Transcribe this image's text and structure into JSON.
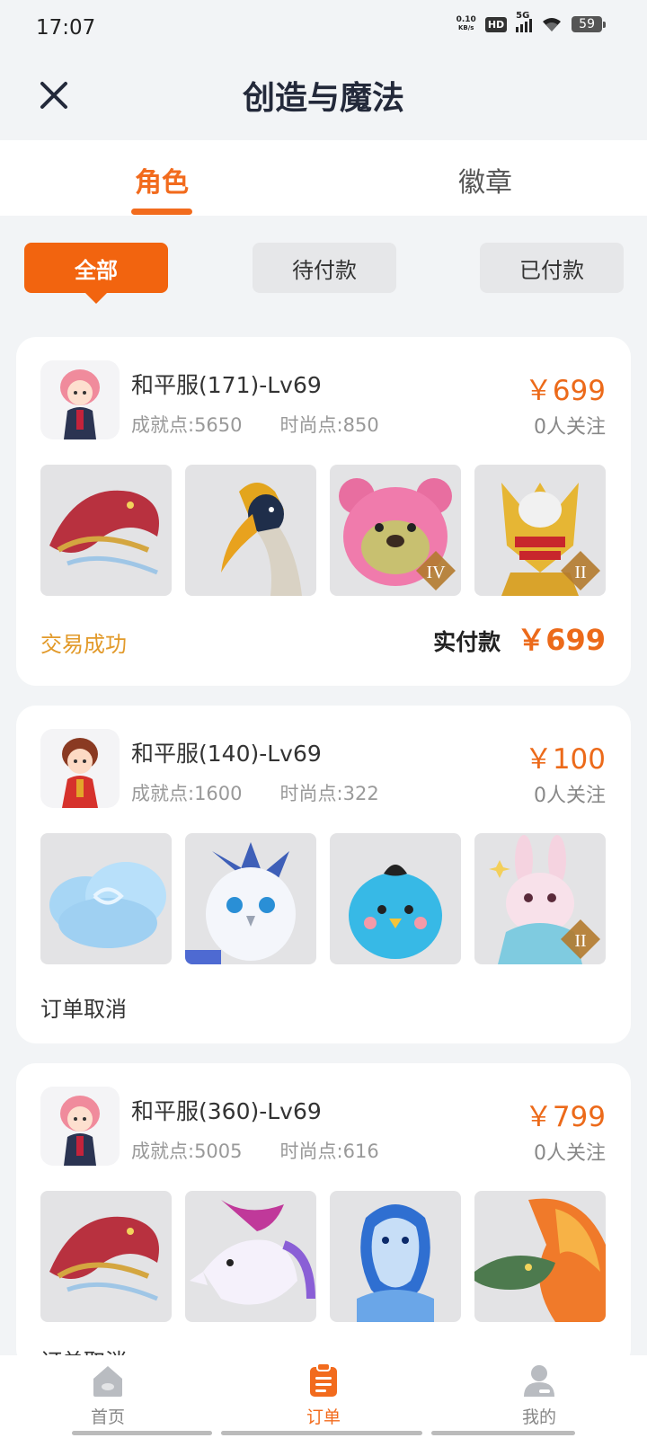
{
  "status_bar": {
    "time": "17:07",
    "net_speed_value": "0.10",
    "net_speed_unit": "KB/s",
    "hd": "HD",
    "network": "5G",
    "battery": "59"
  },
  "header": {
    "title": "创造与魔法",
    "close_icon": "close-icon"
  },
  "tabs": [
    {
      "label": "角色",
      "active": true
    },
    {
      "label": "徽章",
      "active": false
    }
  ],
  "filters": [
    {
      "label": "全部",
      "active": true
    },
    {
      "label": "待付款",
      "active": false
    },
    {
      "label": "已付款",
      "active": false
    }
  ],
  "orders": [
    {
      "title": "和平服(171)-Lv69",
      "achievement": "成就点:5650",
      "fashion": "时尚点:850",
      "price": "￥699",
      "followers": "0人关注",
      "status": "交易成功",
      "paid_label": "实付款",
      "paid_amount": "￥699",
      "thumbs": [
        "red-dragon",
        "hornbill",
        "pink-bear",
        "golden-armor"
      ],
      "tiers": [
        "",
        "",
        "IV",
        "II"
      ]
    },
    {
      "title": "和平服(140)-Lv69",
      "achievement": "成就点:1600",
      "fashion": "时尚点:322",
      "price": "￥100",
      "followers": "0人关注",
      "status": "订单取消",
      "thumbs": [
        "cloud",
        "white-owl",
        "blue-bird",
        "pink-rabbit"
      ],
      "tiers": [
        "",
        "",
        "",
        "II"
      ]
    },
    {
      "title": "和平服(360)-Lv69",
      "achievement": "成就点:5005",
      "fashion": "时尚点:616",
      "price": "￥799",
      "followers": "0人关注",
      "status": "订单取消",
      "thumbs": [
        "red-dragon",
        "white-deer",
        "blue-dragon",
        "fire-dragon"
      ],
      "tiers": [
        "",
        "",
        "",
        ""
      ]
    }
  ],
  "bottom_nav": [
    {
      "label": "首页",
      "icon": "home-icon",
      "active": false
    },
    {
      "label": "订单",
      "icon": "orders-icon",
      "active": true
    },
    {
      "label": "我的",
      "icon": "profile-icon",
      "active": false
    }
  ],
  "colors": {
    "accent": "#f26b1d",
    "success_status": "#e29a2a",
    "title": "#23293a"
  }
}
